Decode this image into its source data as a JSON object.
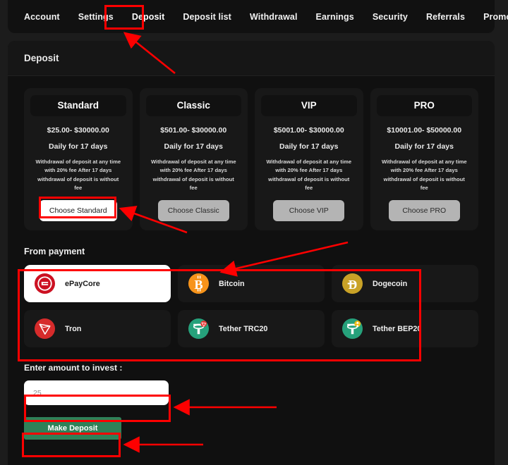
{
  "nav": {
    "items": [
      {
        "label": "Account",
        "active": false
      },
      {
        "label": "Settings",
        "active": false
      },
      {
        "label": "Deposit",
        "active": true
      },
      {
        "label": "Deposit list",
        "active": false
      },
      {
        "label": "Withdrawal",
        "active": false
      },
      {
        "label": "Earnings",
        "active": false
      },
      {
        "label": "Security",
        "active": false
      },
      {
        "label": "Referrals",
        "active": false
      },
      {
        "label": "Promo materials",
        "active": false
      }
    ]
  },
  "panel": {
    "title": "Deposit"
  },
  "plans": [
    {
      "name": "Standard",
      "range": "$25.00- $30000.00",
      "daily": "Daily for 17 days",
      "desc": "Withdrawal of deposit at any time with 20% fee After 17 days withdrawal of deposit is without fee",
      "button": "Choose Standard",
      "chosen": true
    },
    {
      "name": "Classic",
      "range": "$501.00- $30000.00",
      "daily": "Daily for 17 days",
      "desc": "Withdrawal of deposit at any time with 20% fee After 17 days withdrawal of deposit is without fee",
      "button": "Choose Classic",
      "chosen": false
    },
    {
      "name": "VIP",
      "range": "$5001.00- $30000.00",
      "daily": "Daily for 17 days",
      "desc": "Withdrawal of deposit at any time with 20% fee After 17 days withdrawal of deposit is without fee",
      "button": "Choose VIP",
      "chosen": false
    },
    {
      "name": "PRO",
      "range": "$10001.00- $50000.00",
      "daily": "Daily for 17 days",
      "desc": "Withdrawal of deposit at any time with 20% fee After 17 days withdrawal of deposit is without fee",
      "button": "Choose PRO",
      "chosen": false
    }
  ],
  "payment": {
    "label": "From payment",
    "methods": [
      {
        "name": "ePayCore",
        "icon": "epaycore-icon",
        "color": "#cc1122",
        "selected": true
      },
      {
        "name": "Bitcoin",
        "icon": "bitcoin-icon",
        "color": "#f7931a",
        "selected": false
      },
      {
        "name": "Dogecoin",
        "icon": "dogecoin-icon",
        "color": "#c9a227",
        "selected": false
      },
      {
        "name": "Tron",
        "icon": "tron-icon",
        "color": "#d62b2b",
        "selected": false
      },
      {
        "name": "Tether TRC20",
        "icon": "tether-trc20-icon",
        "color": "#26a17b",
        "badge": "#e8312f",
        "selected": false
      },
      {
        "name": "Tether BEP20",
        "icon": "tether-bep20-icon",
        "color": "#26a17b",
        "badge": "#f0b90b",
        "selected": false
      }
    ]
  },
  "amount": {
    "label": "Enter amount to invest :",
    "value": "",
    "placeholder": "25"
  },
  "submit": {
    "label": "Make Deposit"
  },
  "annotations": {
    "accent": "#fe0000",
    "highlights": [
      "deposit-tab",
      "choose-standard-button",
      "payment-grid",
      "amount-input",
      "make-deposit-button"
    ]
  }
}
